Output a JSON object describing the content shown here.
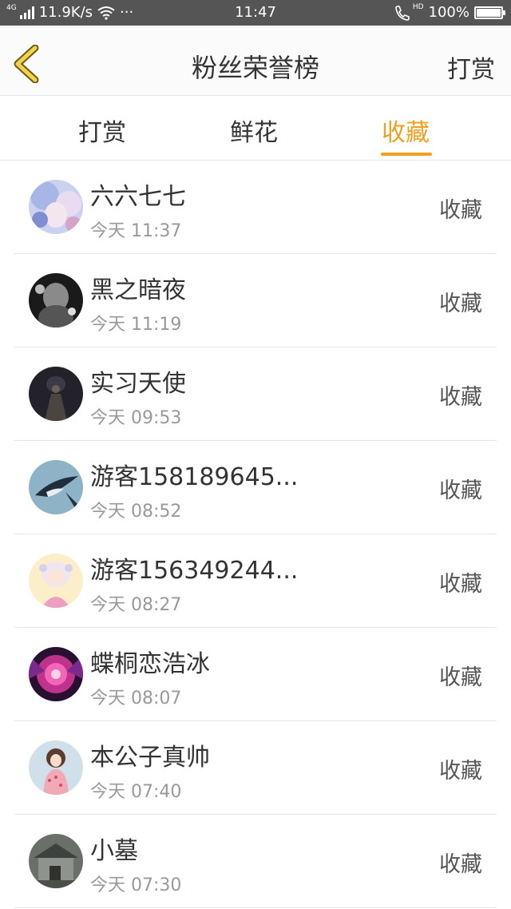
{
  "status_bar": {
    "network_tag": "4G",
    "speed": "11.9K/s",
    "dots": "···",
    "time": "11:47",
    "hd_tag": "HD",
    "battery": "100%",
    "battery_level": 1.0
  },
  "header": {
    "title": "粉丝荣誉榜",
    "action_label": "打赏"
  },
  "tabs": [
    {
      "label": "打赏",
      "active": false
    },
    {
      "label": "鲜花",
      "active": false
    },
    {
      "label": "收藏",
      "active": true
    }
  ],
  "colors": {
    "accent": "#f0a020",
    "text_primary": "#333333",
    "text_secondary": "#999999",
    "status_bar_bg": "#555555"
  },
  "fans": [
    {
      "name": "六六七七",
      "time": "今天 11:37",
      "action": "收藏",
      "avatar": "anime-girl-avatar"
    },
    {
      "name": "黑之暗夜",
      "time": "今天 11:19",
      "action": "收藏",
      "avatar": "dark-figure-avatar"
    },
    {
      "name": "实习天使",
      "time": "今天 09:53",
      "action": "收藏",
      "avatar": "dark-angel-avatar"
    },
    {
      "name": "游客158189645...",
      "time": "今天 08:52",
      "action": "收藏",
      "avatar": "magpie-bird-avatar"
    },
    {
      "name": "游客156349244...",
      "time": "今天 08:27",
      "action": "收藏",
      "avatar": "pink-maid-avatar"
    },
    {
      "name": "蝶桐恋浩冰",
      "time": "今天 08:07",
      "action": "收藏",
      "avatar": "pink-flower-avatar"
    },
    {
      "name": "本公子真帅",
      "time": "今天 07:40",
      "action": "收藏",
      "avatar": "pajama-girl-avatar"
    },
    {
      "name": "小墓",
      "time": "今天 07:30",
      "action": "收藏",
      "avatar": "grey-house-avatar"
    }
  ]
}
